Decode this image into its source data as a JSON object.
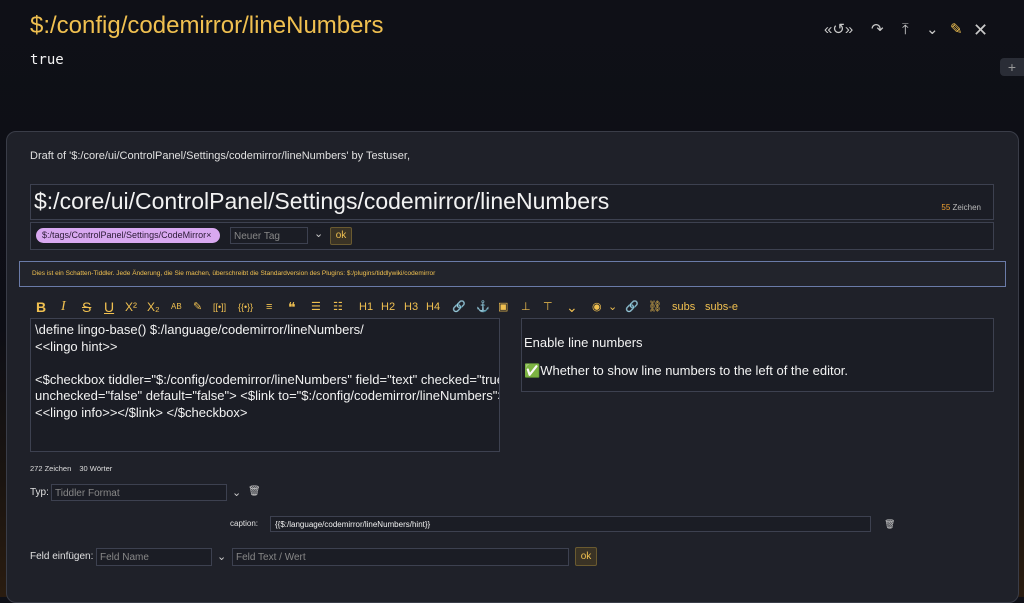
{
  "tiddler": {
    "title": "$:/config/codemirror/lineNumbers",
    "value": "true"
  },
  "toolbar_icons": [
    "history-icon",
    "redo-icon",
    "collapse-others-icon",
    "more-chevron-icon",
    "edit-pencil-icon",
    "close-icon"
  ],
  "editor": {
    "draft_info": "Draft of '$:/core/ui/ControlPanel/Settings/codemirror/lineNumbers' by Testuser,",
    "title": "$:/core/ui/ControlPanel/Settings/codemirror/lineNumbers",
    "title_count": "55",
    "title_count_suffix": "Zeichen",
    "tag": "$:/tags/ControlPanel/Settings/CodeMirror",
    "tag_remove": "×",
    "new_tag_placeholder": "Neuer Tag",
    "ok_label": "ok",
    "shadow_notice": "Dies ist ein Schatten-Tiddler. Jede Änderung, die Sie machen, überschreibt die Standardversion des Plugins: $:/plugins/tiddlywiki/codemirror",
    "text_lines": [
      "\\define lingo-base() $:/language/codemirror/lineNumbers/",
      "<<lingo hint>>",
      "",
      "<$checkbox tiddler=\"$:/config/codemirror/lineNumbers\" field=\"text\" checked=\"true\"",
      "unchecked=\"false\" default=\"false\"> <$link to=\"$:/config/codemirror/lineNumbers\">",
      "<<lingo info>></$link> </$checkbox>"
    ],
    "char_count": "272 Zeichen",
    "word_count": "30 Wörter"
  },
  "formatting_toolbar": {
    "items": [
      "B",
      "I",
      "S",
      "U",
      "X²",
      "X₂",
      "AB",
      "✎",
      "[[•]]",
      "{{•}}",
      "≡",
      "❝",
      "☰",
      "☷",
      "H1",
      "H2",
      "H3",
      "H4",
      "🔗",
      "⚓",
      "▣",
      "⊥",
      "⊤",
      "⌄",
      "◉",
      "⌄",
      "🔗",
      "⛓",
      "subs",
      "subs-e"
    ],
    "item_names": [
      "bold-icon",
      "italic-icon",
      "strikethrough-icon",
      "underline-icon",
      "superscript-icon",
      "subscript-icon",
      "smallcaps-icon",
      "clear-format-icon",
      "wikilink-icon",
      "transclude-icon",
      "stamp-icon",
      "quote-icon",
      "bullet-list-icon",
      "number-list-icon",
      "heading1-button",
      "heading2-button",
      "heading3-button",
      "heading4-button",
      "link-icon",
      "anchor-icon",
      "image-icon",
      "stamp2-icon",
      "excise-icon",
      "more-icon",
      "preview-icon",
      "preview-type-icon",
      "link2-icon",
      "linkify-icon",
      "subs-button",
      "subs-e-button"
    ]
  },
  "preview": {
    "heading": "Enable line numbers",
    "check": "✅",
    "description": "Whether to show line numbers to the left of the editor."
  },
  "type_field": {
    "label": "Typ:",
    "placeholder": "Tiddler Format"
  },
  "caption_field": {
    "label": "caption:",
    "value": "{{$:/language/codemirror/lineNumbers/hint}}"
  },
  "add_field": {
    "label": "Feld einfügen:",
    "name_placeholder": "Feld Name",
    "text_placeholder": "Feld Text / Wert",
    "ok_label": "ok"
  },
  "colors": {
    "accent": "#f0c050",
    "tag_pill": "#d8a8f0",
    "background": "#0f1017",
    "panel": "#1f2129"
  }
}
